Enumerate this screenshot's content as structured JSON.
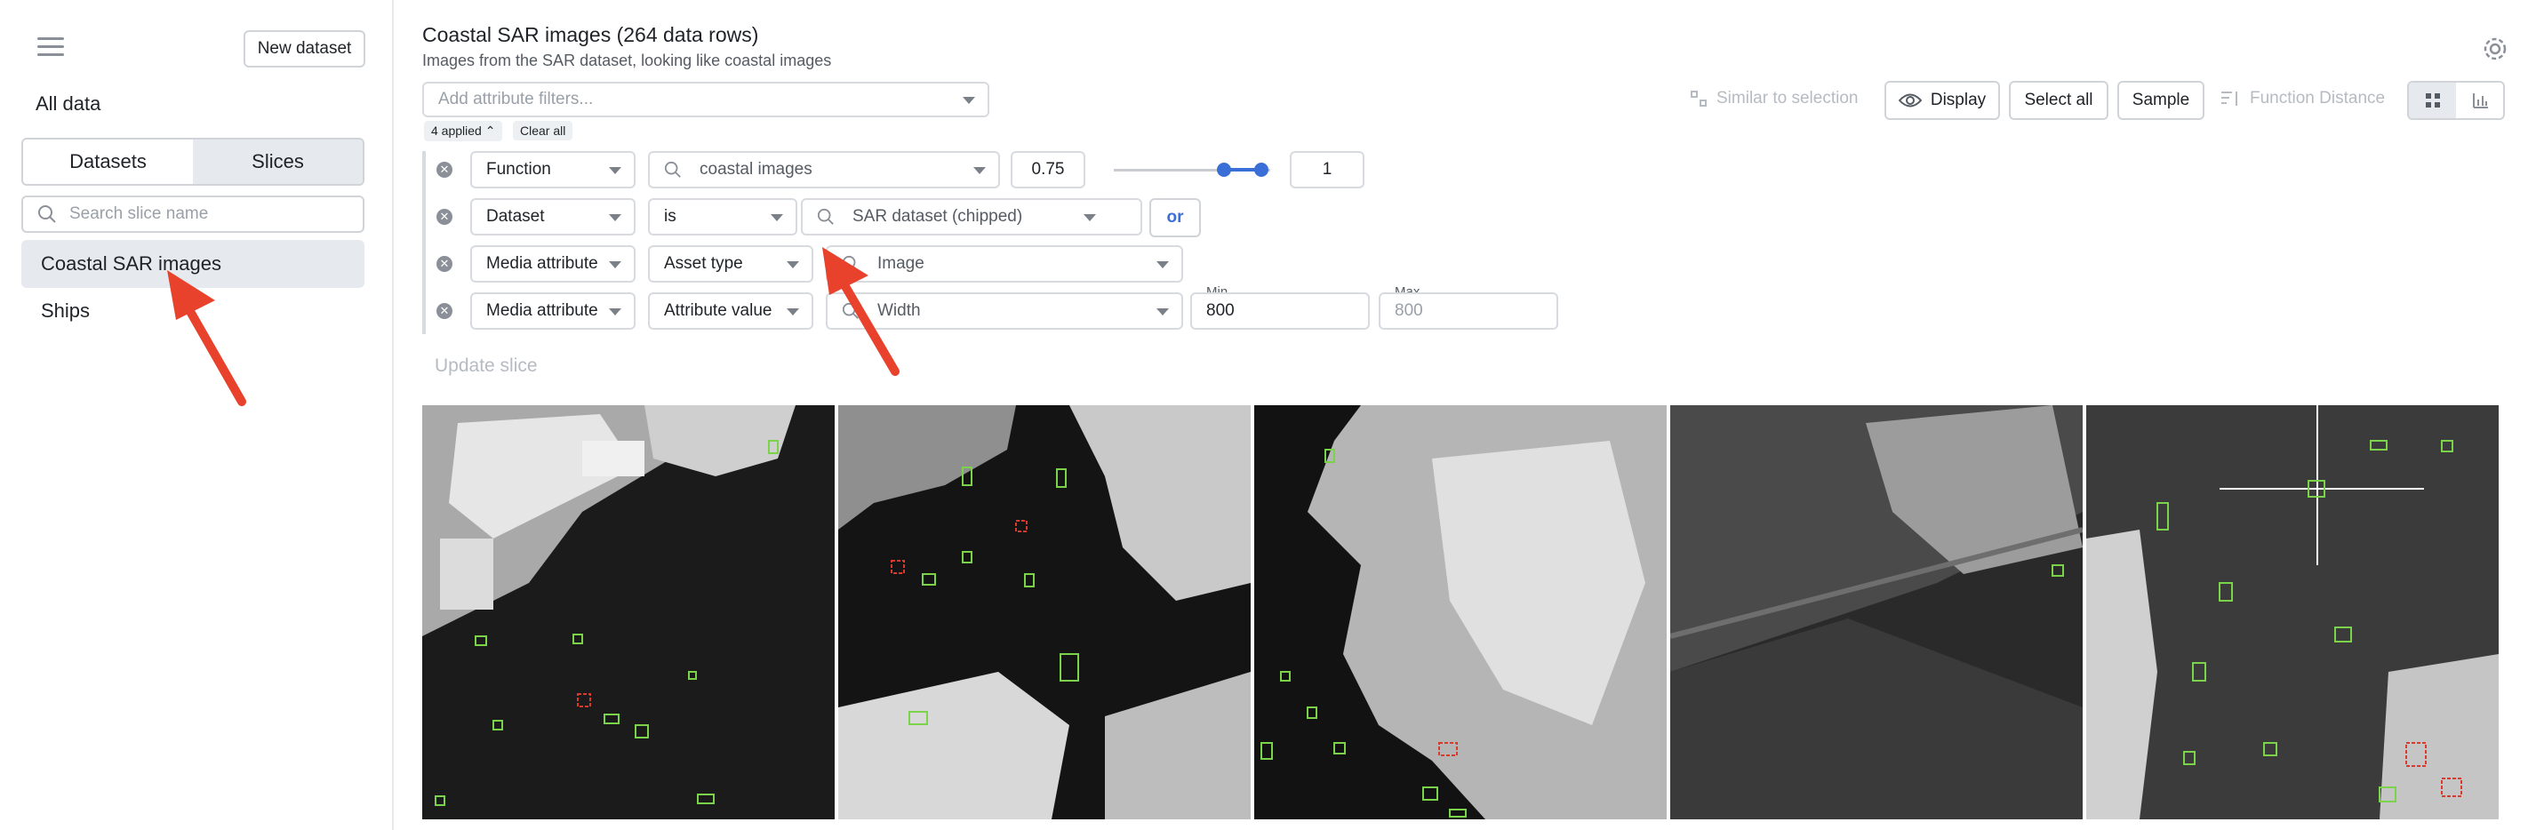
{
  "sidebar": {
    "new_dataset_label": "New dataset",
    "all_data_label": "All data",
    "tabs": [
      {
        "label": "Datasets"
      },
      {
        "label": "Slices"
      }
    ],
    "search_placeholder": "Search slice name",
    "slices": [
      {
        "label": "Coastal SAR images"
      },
      {
        "label": "Ships"
      }
    ]
  },
  "header": {
    "title": "Coastal SAR images (264 data rows)",
    "subtitle": "Images from the SAR dataset, looking like coastal images"
  },
  "attribute_filter": {
    "placeholder": "Add attribute filters...",
    "applied_label": "4 applied",
    "clear_all_label": "Clear all"
  },
  "toolbar": {
    "similar_label": "Similar to selection",
    "display_label": "Display",
    "select_all_label": "Select all",
    "sample_label": "Sample",
    "function_distance_label": "Function Distance"
  },
  "filters": [
    {
      "field": "Function",
      "query": "coastal images",
      "min_value": "0.75",
      "max_value": "1",
      "slider_low": 0.75,
      "slider_high": 1.0
    },
    {
      "field": "Dataset",
      "operator": "is",
      "value": "SAR dataset (chipped)",
      "or_label": "or"
    },
    {
      "field": "Media attribute",
      "sub": "Asset type",
      "value": "Image"
    },
    {
      "field": "Media attribute",
      "sub": "Attribute value",
      "value": "Width",
      "min_label": "Min",
      "min_value": "800",
      "max_label": "Max",
      "max_placeholder": "800"
    }
  ],
  "update_slice_label": "Update slice",
  "colors": {
    "accent": "#3b6fd8",
    "annotation_red": "#e8422d",
    "box_green": "#7bd34a",
    "box_red": "#d83a2e"
  },
  "icons": [
    "menu-icon",
    "search-icon",
    "eye-icon",
    "gear-icon",
    "grid-icon",
    "chart-icon",
    "close-icon",
    "sort-icon",
    "similar-icon"
  ]
}
